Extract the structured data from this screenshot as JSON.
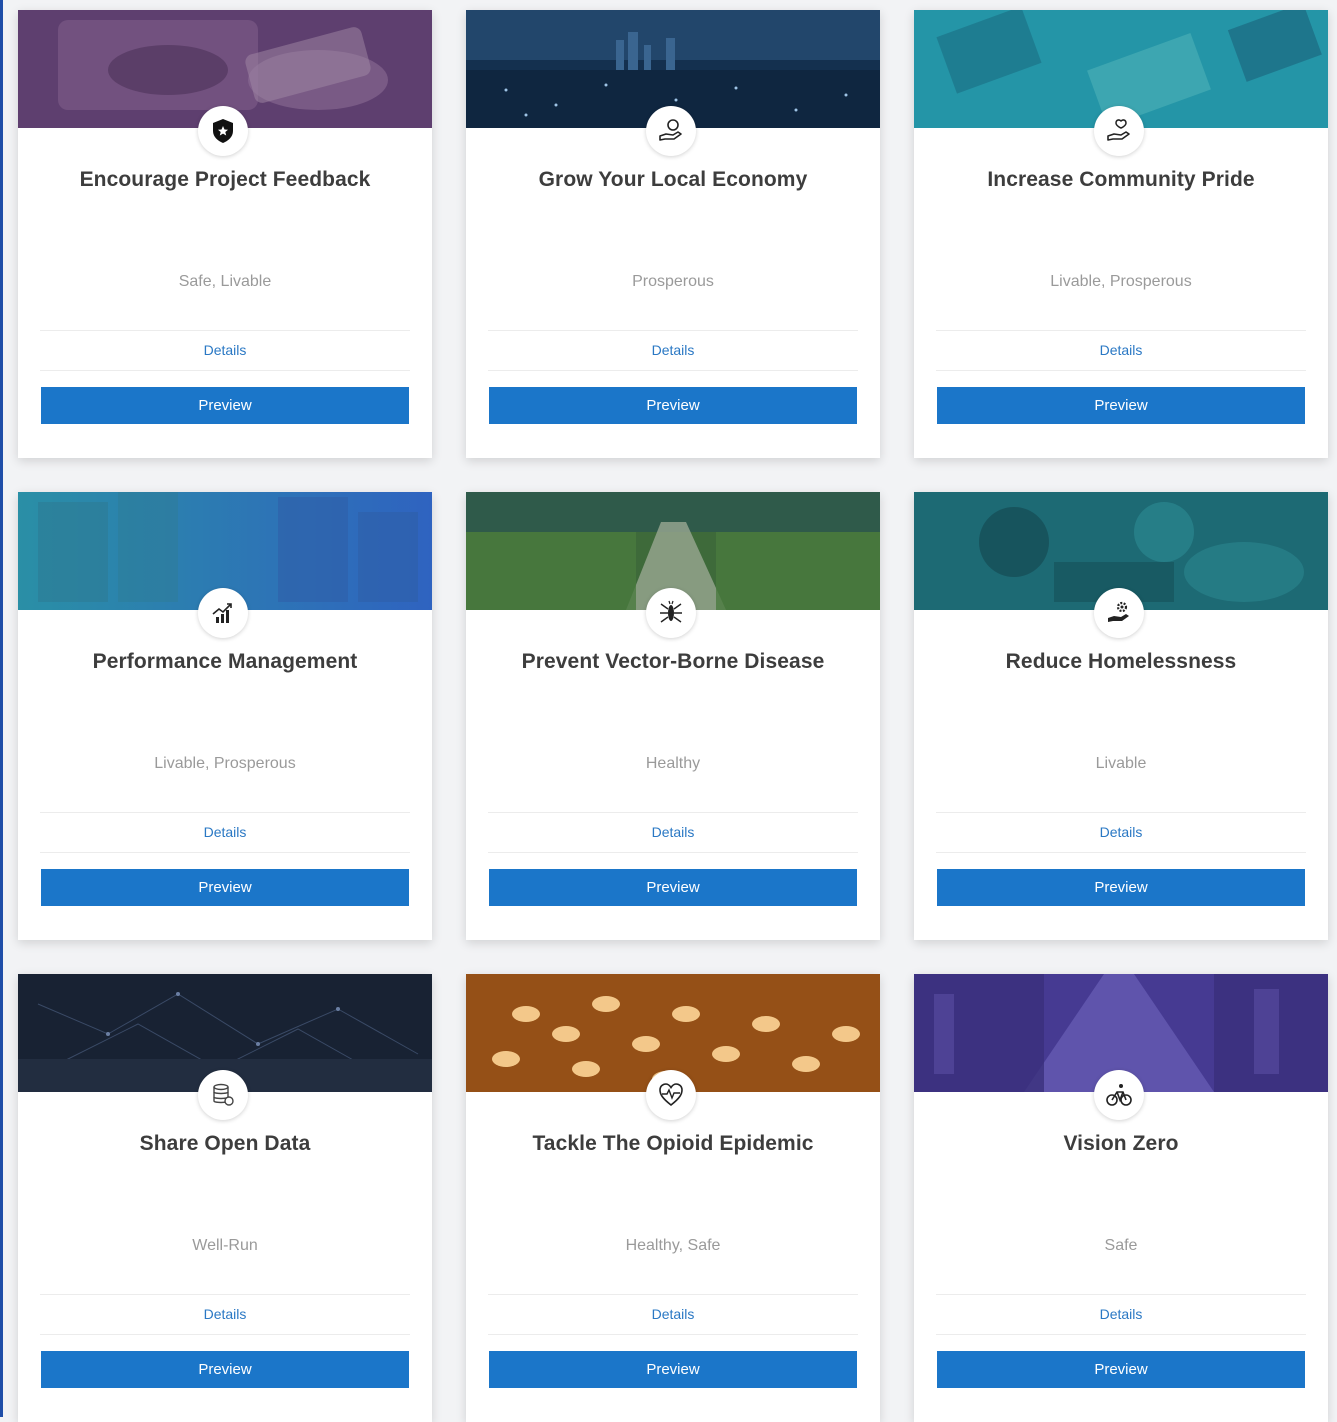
{
  "cards": [
    {
      "title": "Encourage Project Feedback",
      "tags": "Safe, Livable",
      "details_label": "Details",
      "preview_label": "Preview",
      "icon": "shield-icon",
      "banner_color": "#6b4a7a"
    },
    {
      "title": "Grow Your Local Economy",
      "tags": "Prosperous",
      "details_label": "Details",
      "preview_label": "Preview",
      "icon": "hand-coin-icon",
      "banner_color": "#16365c"
    },
    {
      "title": "Increase Community Pride",
      "tags": "Livable, Prosperous",
      "details_label": "Details",
      "preview_label": "Preview",
      "icon": "hand-heart-icon",
      "banner_color": "#1f8fa3"
    },
    {
      "title": "Performance Management",
      "tags": "Livable, Prosperous",
      "details_label": "Details",
      "preview_label": "Preview",
      "icon": "chart-growth-icon",
      "banner_color": "#2f6fb0"
    },
    {
      "title": "Prevent Vector-Borne Disease",
      "tags": "Healthy",
      "details_label": "Details",
      "preview_label": "Preview",
      "icon": "mosquito-icon",
      "banner_color": "#3f6f3c"
    },
    {
      "title": "Reduce Homelessness",
      "tags": "Livable",
      "details_label": "Details",
      "preview_label": "Preview",
      "icon": "hand-gear-icon",
      "banner_color": "#1d6f7a"
    },
    {
      "title": "Share Open Data",
      "tags": "Well-Run",
      "details_label": "Details",
      "preview_label": "Preview",
      "icon": "database-icon",
      "banner_color": "#1a2436"
    },
    {
      "title": "Tackle The Opioid Epidemic",
      "tags": "Healthy, Safe",
      "details_label": "Details",
      "preview_label": "Preview",
      "icon": "heart-pulse-icon",
      "banner_color": "#d97a22"
    },
    {
      "title": "Vision Zero",
      "tags": "Safe",
      "details_label": "Details",
      "preview_label": "Preview",
      "icon": "cyclist-icon",
      "banner_color": "#4b3f9c"
    }
  ]
}
